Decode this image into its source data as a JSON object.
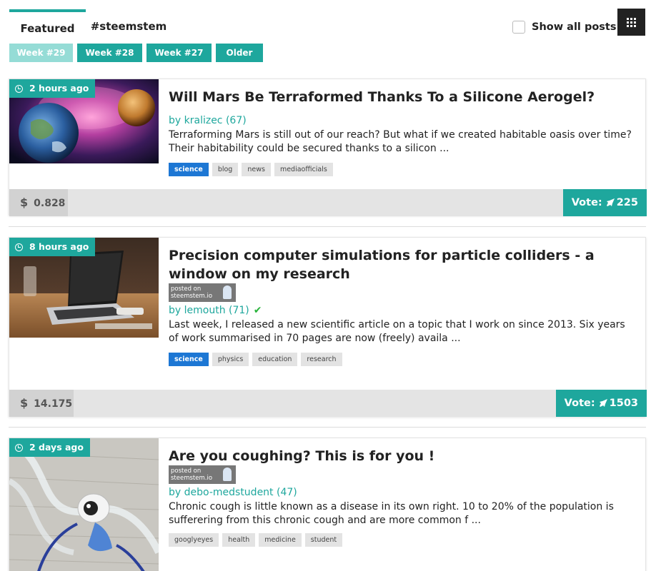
{
  "tabs": [
    {
      "label": "Featured",
      "active": true
    },
    {
      "label": "#steemstem",
      "active": false
    }
  ],
  "show_all": {
    "label": "Show all posts",
    "checked": false
  },
  "grid_icon": "grid-icon",
  "weeks": [
    {
      "label": "Week #29",
      "active": true
    },
    {
      "label": "Week #28",
      "active": false
    },
    {
      "label": "Week #27",
      "active": false
    },
    {
      "label": "Older",
      "active": false
    }
  ],
  "posted_on": {
    "line1": "posted on",
    "line2": "steemstem.io"
  },
  "posts": [
    {
      "time": "2 hours ago",
      "title": "Will Mars Be Terraformed Thanks To a Silicone Aerogel?",
      "posted_on_badge": false,
      "author": "by kralizec (67)",
      "verified": false,
      "excerpt": "Terraforming Mars is still out of our reach? But what if we created habitable oasis over time? Their habitability could be secured thanks to a silicon ...",
      "tags": [
        "science",
        "blog",
        "news",
        "mediaofficials"
      ],
      "payout": "0.828",
      "vote_label": "Vote:",
      "votes": "225"
    },
    {
      "time": "8 hours ago",
      "title": "Precision computer simulations for particle colliders - a window on my research",
      "posted_on_badge": true,
      "author": "by lemouth (71)",
      "verified": true,
      "excerpt": "Last week, I released a new scientific article on a topic that I work on since 2013. Six years of work summarised in 70 pages are now (freely) availa ...",
      "tags": [
        "science",
        "physics",
        "education",
        "research"
      ],
      "payout": "14.175",
      "vote_label": "Vote:",
      "votes": "1503"
    },
    {
      "time": "2 days ago",
      "title": "Are you coughing? This is for you !",
      "posted_on_badge": true,
      "author": "by debo-medstudent (47)",
      "verified": false,
      "excerpt": "Chronic cough is little known as a disease in its own right. 10 to 20% of the population is sufferering from this chronic cough and are more common f ...",
      "tags": [
        "googlyeyes",
        "health",
        "medicine",
        "student"
      ]
    }
  ],
  "symbols": {
    "dollar": "$",
    "check": "✔",
    "rocket": "🚀"
  },
  "colors": {
    "accent": "#1ea79d",
    "accent_light": "#95dcd6",
    "primary_tag": "#1d77d4",
    "verified": "#27b33a"
  }
}
